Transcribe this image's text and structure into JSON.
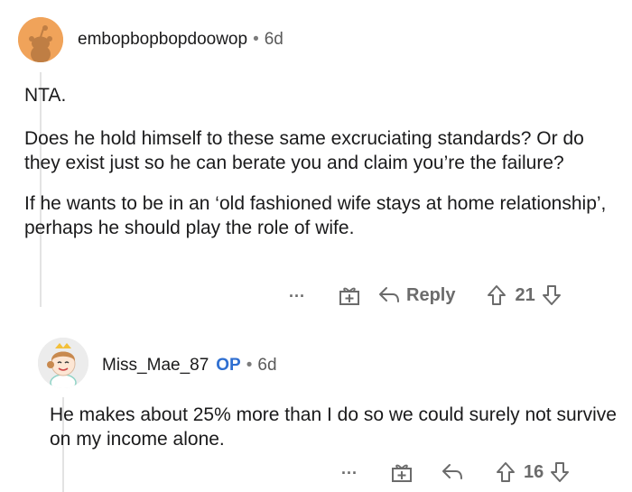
{
  "comment1": {
    "username": "embopbopbopdoowop",
    "separator": "•",
    "age": "6d",
    "paragraphs": [
      "NTA.",
      "Does he hold himself to these same excruciating standards? Or do they exist just so he can berate you and claim you’re the failure?",
      "If he wants to be in an ‘old fashioned wife stays at home relationship’, perhaps he should play the role of wife."
    ],
    "more": "...",
    "reply_label": "Reply",
    "score": "21",
    "avatar_color": "#f0a35a"
  },
  "comment2": {
    "username": "Miss_Mae_87",
    "op_badge": "OP",
    "separator": "•",
    "age": "6d",
    "paragraphs": [
      "He makes about 25% more than I do so we could surely not survive on my income alone."
    ],
    "more": "...",
    "score": "16"
  }
}
